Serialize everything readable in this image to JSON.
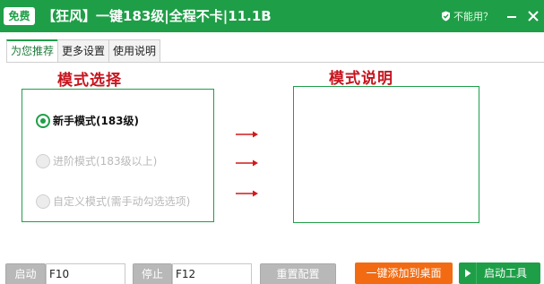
{
  "titlebar": {
    "badge": "免费",
    "title": "【狂风】一键183级|全程不卡|11.1B",
    "help_label": "不能用？"
  },
  "tabs": [
    {
      "label": "为您推荐"
    },
    {
      "label": "更多设置"
    },
    {
      "label": "使用说明"
    }
  ],
  "mode_panel": {
    "title": "模式选择",
    "options": [
      {
        "label": "新手模式(183级)",
        "selected": true
      },
      {
        "label": "进阶模式(183级以上)",
        "selected": false
      },
      {
        "label": "自定义模式(需手动勾选选项)",
        "selected": false
      }
    ]
  },
  "desc_panel": {
    "title": "模式说明"
  },
  "bottom": {
    "start_label": "启动",
    "start_key": "F10",
    "stop_label": "停止",
    "stop_key": "F12",
    "reset_label": "重置配置",
    "add_desktop_label": "一键添加到桌面",
    "launch_label": "启动工具"
  },
  "colors": {
    "brand_green": "#1f9e48",
    "accent_red": "#c8141e",
    "orange": "#f26b12"
  },
  "icons": [
    "shield-check-icon",
    "minimize-icon",
    "close-icon",
    "arrow-right-icon",
    "play-icon"
  ]
}
